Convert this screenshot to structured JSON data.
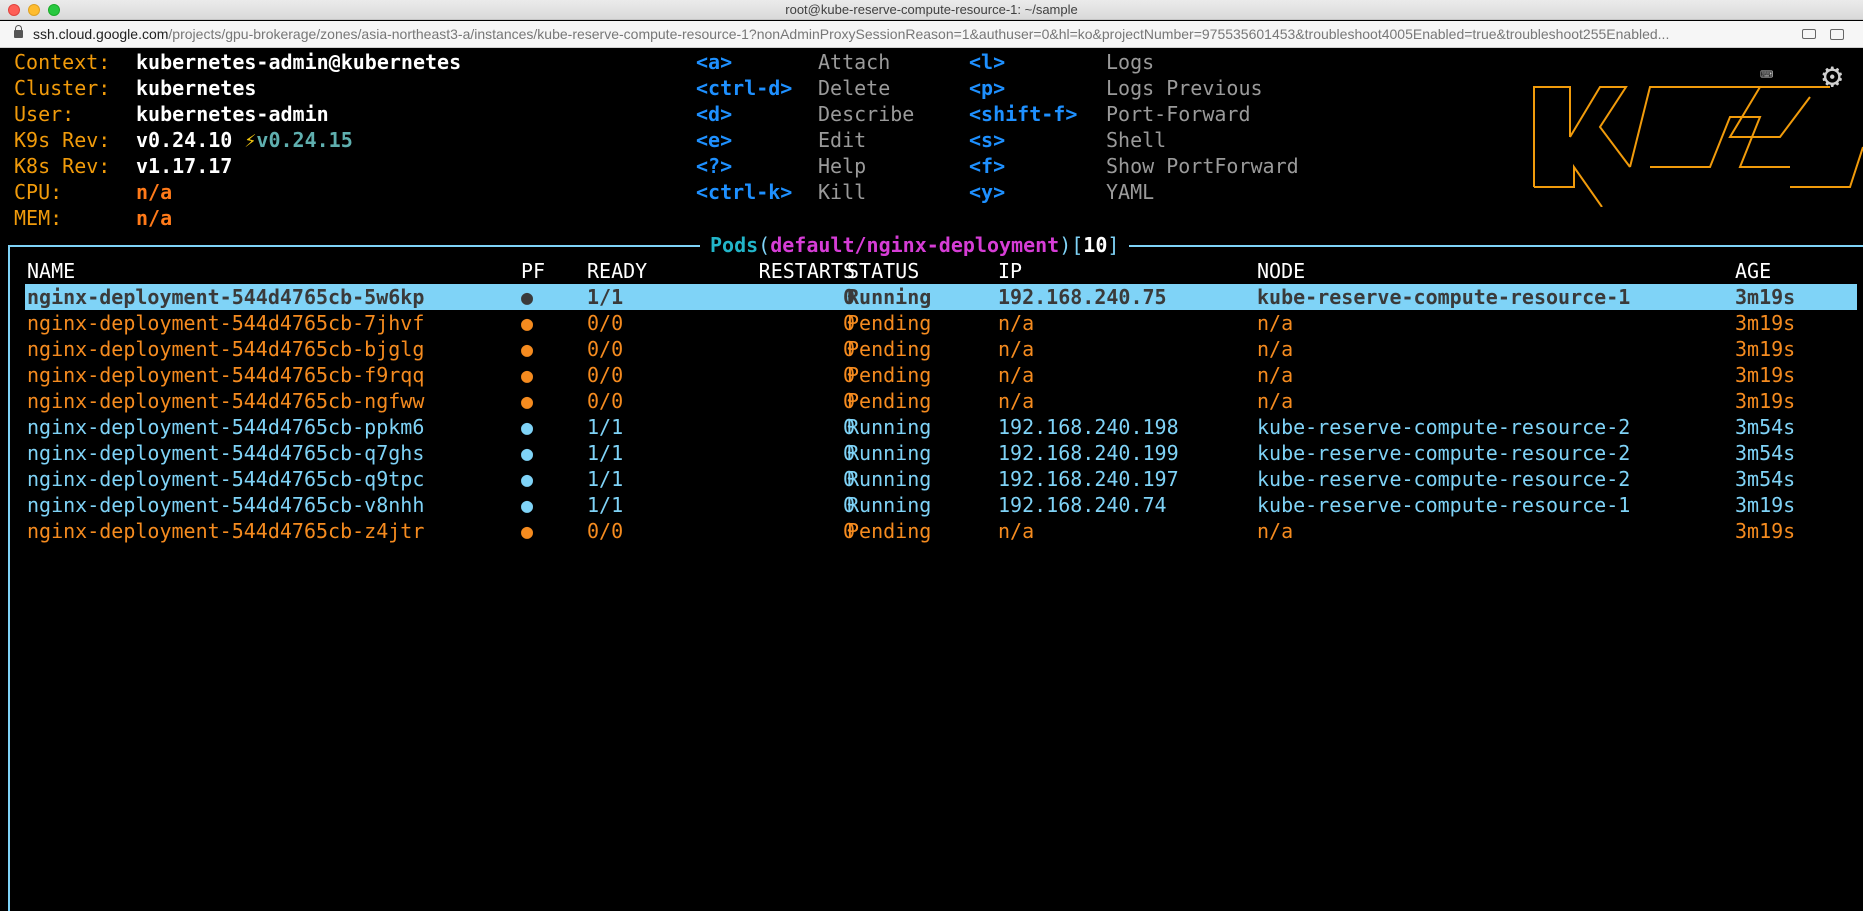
{
  "window": {
    "title": "root@kube-reserve-compute-resource-1: ~/sample"
  },
  "browser": {
    "url_domain": "ssh.cloud.google.com",
    "url_path": "/projects/gpu-brokerage/zones/asia-northeast3-a/instances/kube-reserve-compute-resource-1?nonAdminProxySessionReason=1&authuser=0&hl=ko&projectNumber=975535601453&troubleshoot4005Enabled=true&troubleshoot255Enabled..."
  },
  "info": {
    "context_label": "Context:",
    "context_value": "kubernetes-admin@kubernetes",
    "cluster_label": "Cluster:",
    "cluster_value": "kubernetes",
    "user_label": "User:",
    "user_value": "kubernetes-admin",
    "k9s_label": "K9s Rev:",
    "k9s_value": "v0.24.10",
    "k9s_upgrade_icon": "⚡",
    "k9s_upgrade": "v0.24.15",
    "k8s_label": "K8s Rev:",
    "k8s_value": "v1.17.17",
    "cpu_label": "CPU:",
    "cpu_value": "n/a",
    "mem_label": "MEM:",
    "mem_value": "n/a"
  },
  "hotkeys": {
    "col1": [
      {
        "key": "<a>",
        "action": "Attach"
      },
      {
        "key": "<ctrl-d>",
        "action": "Delete"
      },
      {
        "key": "<d>",
        "action": "Describe"
      },
      {
        "key": "<e>",
        "action": "Edit"
      },
      {
        "key": "<?>",
        "action": "Help"
      },
      {
        "key": "<ctrl-k>",
        "action": "Kill"
      }
    ],
    "col2": [
      {
        "key": "<l>",
        "action": "Logs"
      },
      {
        "key": "<p>",
        "action": "Logs Previous"
      },
      {
        "key": "<shift-f>",
        "action": "Port-Forward"
      },
      {
        "key": "<s>",
        "action": "Shell"
      },
      {
        "key": "<f>",
        "action": "Show PortForward"
      },
      {
        "key": "<y>",
        "action": "YAML"
      }
    ]
  },
  "pods": {
    "title_resource": "Pods",
    "title_open": "(",
    "title_scope": "default/nginx-deployment",
    "title_close": ")",
    "count_open": "[",
    "count": "10",
    "count_close": "]",
    "headers": {
      "name": "NAME",
      "pf": "PF",
      "ready": "READY",
      "restarts": "RESTARTS",
      "status": "STATUS",
      "ip": "IP",
      "node": "NODE",
      "age": "AGE"
    },
    "rows": [
      {
        "name": "nginx-deployment-544d4765cb-5w6kp",
        "pf": "●",
        "ready": "1/1",
        "restarts": "0",
        "status": "Running",
        "ip": "192.168.240.75",
        "node": "kube-reserve-compute-resource-1",
        "age": "3m19s"
      },
      {
        "name": "nginx-deployment-544d4765cb-7jhvf",
        "pf": "●",
        "ready": "0/0",
        "restarts": "0",
        "status": "Pending",
        "ip": "n/a",
        "node": "n/a",
        "age": "3m19s"
      },
      {
        "name": "nginx-deployment-544d4765cb-bjglg",
        "pf": "●",
        "ready": "0/0",
        "restarts": "0",
        "status": "Pending",
        "ip": "n/a",
        "node": "n/a",
        "age": "3m19s"
      },
      {
        "name": "nginx-deployment-544d4765cb-f9rqq",
        "pf": "●",
        "ready": "0/0",
        "restarts": "0",
        "status": "Pending",
        "ip": "n/a",
        "node": "n/a",
        "age": "3m19s"
      },
      {
        "name": "nginx-deployment-544d4765cb-ngfww",
        "pf": "●",
        "ready": "0/0",
        "restarts": "0",
        "status": "Pending",
        "ip": "n/a",
        "node": "n/a",
        "age": "3m19s"
      },
      {
        "name": "nginx-deployment-544d4765cb-ppkm6",
        "pf": "●",
        "ready": "1/1",
        "restarts": "0",
        "status": "Running",
        "ip": "192.168.240.198",
        "node": "kube-reserve-compute-resource-2",
        "age": "3m54s"
      },
      {
        "name": "nginx-deployment-544d4765cb-q7ghs",
        "pf": "●",
        "ready": "1/1",
        "restarts": "0",
        "status": "Running",
        "ip": "192.168.240.199",
        "node": "kube-reserve-compute-resource-2",
        "age": "3m54s"
      },
      {
        "name": "nginx-deployment-544d4765cb-q9tpc",
        "pf": "●",
        "ready": "1/1",
        "restarts": "0",
        "status": "Running",
        "ip": "192.168.240.197",
        "node": "kube-reserve-compute-resource-2",
        "age": "3m54s"
      },
      {
        "name": "nginx-deployment-544d4765cb-v8nhh",
        "pf": "●",
        "ready": "1/1",
        "restarts": "0",
        "status": "Running",
        "ip": "192.168.240.74",
        "node": "kube-reserve-compute-resource-1",
        "age": "3m19s"
      },
      {
        "name": "nginx-deployment-544d4765cb-z4jtr",
        "pf": "●",
        "ready": "0/0",
        "restarts": "0",
        "status": "Pending",
        "ip": "n/a",
        "node": "n/a",
        "age": "3m19s"
      }
    ]
  },
  "logo": {
    "text": "K9s",
    "color": "#f19b0b"
  },
  "colors": {
    "running": "#7fd3f7",
    "pending": "#f58b1f",
    "selected_bg": "#7fd3f7"
  }
}
